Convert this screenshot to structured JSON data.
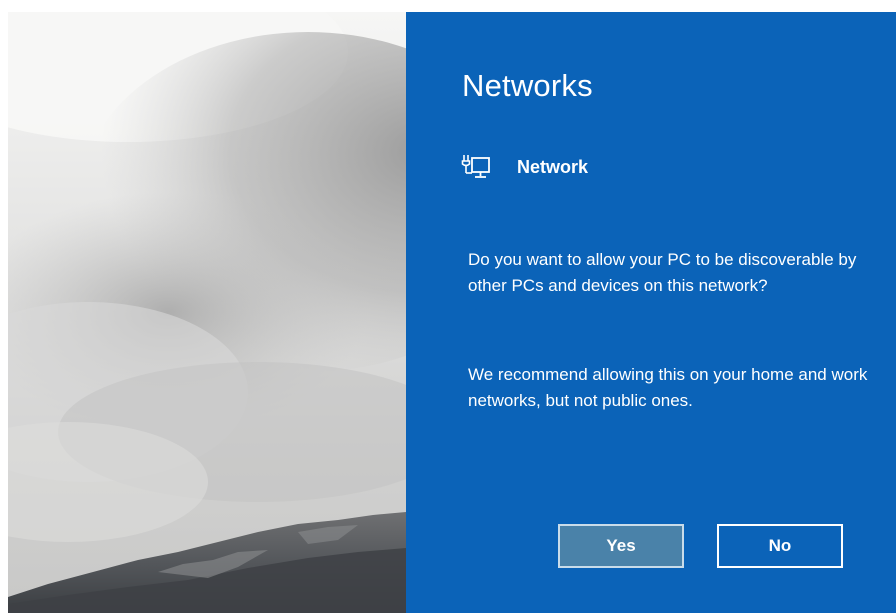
{
  "panel": {
    "title": "Networks",
    "network_name": "Network",
    "network_icon": "network-computer-icon",
    "question": "Do you want to allow your PC to be discoverable by other PCs and devices on this network?",
    "recommendation": "We recommend allowing this on your home and work networks, but not public ones.",
    "yes_label": "Yes",
    "no_label": "No",
    "background_color": "#0b63b8"
  }
}
